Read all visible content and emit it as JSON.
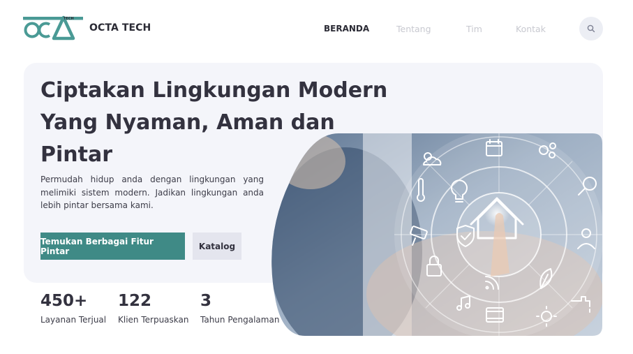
{
  "header": {
    "logo_text": "OCTA",
    "logo_sub": "TECH",
    "brand": "OCTA TECH",
    "nav": [
      {
        "label": "BERANDA",
        "active": true
      },
      {
        "label": "Tentang",
        "active": false
      },
      {
        "label": "Tim",
        "active": false
      },
      {
        "label": "Kontak",
        "active": false
      }
    ],
    "search_icon": "search-icon"
  },
  "hero": {
    "title_line1": "Ciptakan Lingkungan Modern",
    "title_line2": "Yang Nyaman, Aman dan",
    "title_line3": "Pintar",
    "description": "Permudah hidup anda dengan lingkungan yang melimiki sistem modern. Jadikan lingkungan anda lebih pintar bersama kami.",
    "primary_button": "Temukan Berbagai Fitur Pintar",
    "secondary_button": "Katalog"
  },
  "stats": [
    {
      "value": "450+",
      "label": "Layanan Terjual"
    },
    {
      "value": "122",
      "label": "Klien Terpuaskan"
    },
    {
      "value": "3",
      "label": "Tahun Pengalaman"
    }
  ],
  "colors": {
    "accent": "#3f8a86",
    "text_dark": "#33323f",
    "panel_bg": "#f4f5fa",
    "nav_inactive": "#c8c9d0"
  },
  "hero_image_icons": [
    "weather-icon",
    "calendar-icon",
    "gears-icon",
    "thermometer-icon",
    "bulb-icon",
    "home-icon",
    "analytics-icon",
    "camera-icon",
    "shield-icon",
    "user-icon",
    "lock-icon",
    "wifi-icon",
    "leaf-icon",
    "music-icon",
    "film-icon",
    "sun-icon",
    "faucet-icon"
  ]
}
